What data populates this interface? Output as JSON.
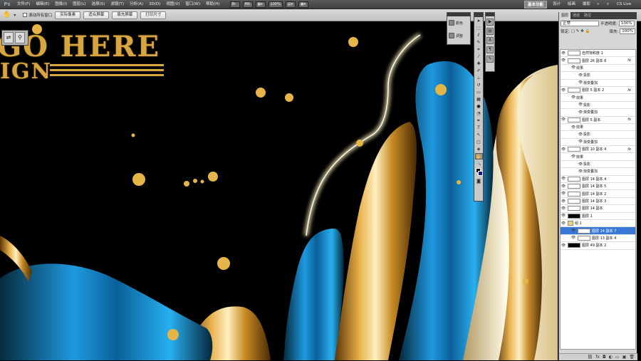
{
  "app": {
    "logo": "Ps",
    "menu": [
      "文件(F)",
      "编辑(E)",
      "图像(I)",
      "图层(L)",
      "选择(S)",
      "滤镜(T)",
      "分析(A)",
      "3D(D)",
      "视图(V)",
      "窗口(W)",
      "帮助(H)"
    ],
    "zoom": "100%",
    "workspace": {
      "active": "基本功能",
      "others": [
        "设计",
        "绘画",
        "摄影"
      ],
      "more": "»",
      "cslive": "CS Live"
    }
  },
  "options_bar": {
    "checkbox_label": "滚动所有窗口",
    "buttons": [
      "实际像素",
      "适合屏幕",
      "填充屏幕",
      "打印尺寸"
    ]
  },
  "canvas": {
    "logo_line1": "GO HERE",
    "logo_line2": "IGN"
  },
  "mini_panel": {
    "items": [
      "颜色",
      "调整"
    ]
  },
  "layers_panel": {
    "tabs": [
      "图层",
      "通道",
      "路径"
    ],
    "blend_mode": "正常",
    "opacity_label": "不透明度:",
    "opacity": "100%",
    "lock_label": "锁定:",
    "fill_label": "填充:",
    "fill": "100%",
    "fx_label": "fx",
    "layers": [
      {
        "name": "自然饱和度 1",
        "type": "adjust",
        "level": 0
      },
      {
        "name": "图层 26 副本 8",
        "type": "layer",
        "level": 0,
        "fx": true
      },
      {
        "name": "效果",
        "type": "effect",
        "level": 1
      },
      {
        "name": "投影",
        "type": "effect",
        "level": 2
      },
      {
        "name": "渐变叠加",
        "type": "effect",
        "level": 2
      },
      {
        "name": "图层 5 副本 2",
        "type": "layer",
        "level": 0,
        "fx": true
      },
      {
        "name": "效果",
        "type": "effect",
        "level": 1
      },
      {
        "name": "投影",
        "type": "effect",
        "level": 2
      },
      {
        "name": "渐变叠加",
        "type": "effect",
        "level": 2
      },
      {
        "name": "图层 5 副本",
        "type": "layer",
        "level": 0,
        "fx": true
      },
      {
        "name": "效果",
        "type": "effect",
        "level": 1
      },
      {
        "name": "投影",
        "type": "effect",
        "level": 2
      },
      {
        "name": "渐变叠加",
        "type": "effect",
        "level": 2
      },
      {
        "name": "图层 10 副本 4",
        "type": "layer",
        "level": 0,
        "fx": true
      },
      {
        "name": "效果",
        "type": "effect",
        "level": 1
      },
      {
        "name": "投影",
        "type": "effect",
        "level": 2
      },
      {
        "name": "渐变叠加",
        "type": "effect",
        "level": 2
      },
      {
        "name": "图层 14 副本 4",
        "type": "layer",
        "level": 0
      },
      {
        "name": "图层 14 副本 5",
        "type": "layer",
        "level": 0
      },
      {
        "name": "图层 14 副本 2",
        "type": "layer",
        "level": 0
      },
      {
        "name": "图层 14 副本 3",
        "type": "layer",
        "level": 0
      },
      {
        "name": "图层 14 副本",
        "type": "layer",
        "level": 0
      },
      {
        "name": "图层 1",
        "type": "layer",
        "level": 0,
        "dark": true
      },
      {
        "name": "组 1",
        "type": "group",
        "level": 0
      },
      {
        "name": "图层 14 副本 7",
        "type": "layer",
        "level": 1,
        "active": true
      },
      {
        "name": "图层 13 副本 4",
        "type": "layer",
        "level": 1
      },
      {
        "name": "图层 49 副本 2",
        "type": "layer",
        "level": 0,
        "dark": true
      }
    ]
  },
  "colors": {
    "gold": "#d7a640",
    "blue": "#1b8bd0",
    "selection": "#3a78d8"
  }
}
